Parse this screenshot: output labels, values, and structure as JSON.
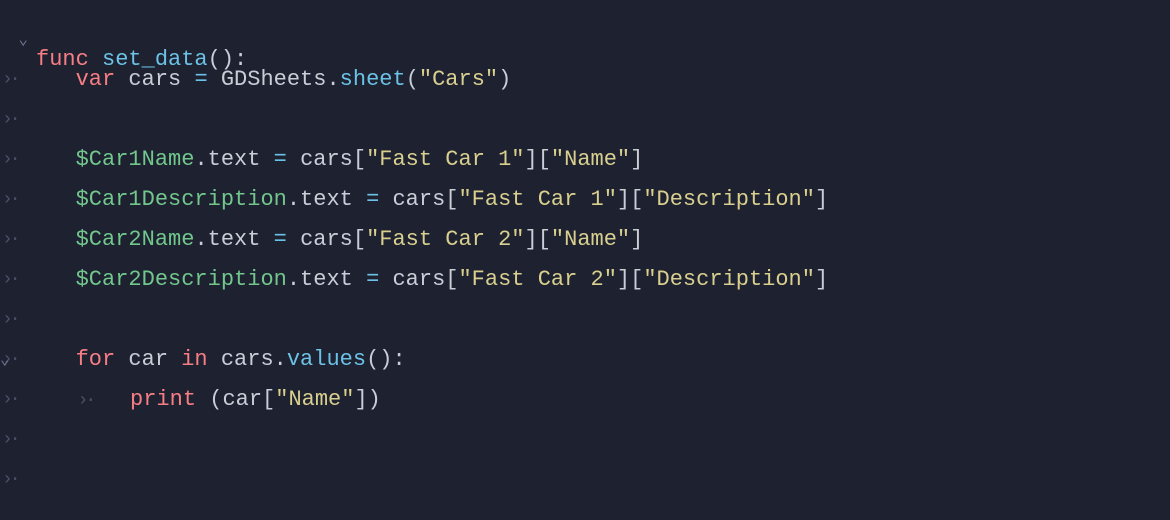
{
  "code": {
    "l1": {
      "func": "func",
      "name": "set_data",
      "parens": "()",
      "colon": ":"
    },
    "l2": {
      "var": "var",
      "cars": "cars",
      "eq": "=",
      "gds": "GDSheets",
      "dot": ".",
      "sheet": "sheet",
      "open": "(",
      "str": "\"Cars\"",
      "close": ")"
    },
    "l4": {
      "node": "$Car1Name",
      "dot": ".",
      "prop": "text",
      "eq": "=",
      "cars": "cars",
      "b1o": "[",
      "s1": "\"Fast Car 1\"",
      "b1c": "]",
      "b2o": "[",
      "s2": "\"Name\"",
      "b2c": "]"
    },
    "l5": {
      "node": "$Car1Description",
      "dot": ".",
      "prop": "text",
      "eq": "=",
      "cars": "cars",
      "b1o": "[",
      "s1": "\"Fast Car 1\"",
      "b1c": "]",
      "b2o": "[",
      "s2": "\"Description\"",
      "b2c": "]"
    },
    "l6": {
      "node": "$Car2Name",
      "dot": ".",
      "prop": "text",
      "eq": "=",
      "cars": "cars",
      "b1o": "[",
      "s1": "\"Fast Car 2\"",
      "b1c": "]",
      "b2o": "[",
      "s2": "\"Name\"",
      "b2c": "]"
    },
    "l7": {
      "node": "$Car2Description",
      "dot": ".",
      "prop": "text",
      "eq": "=",
      "cars": "cars",
      "b1o": "[",
      "s1": "\"Fast Car 2\"",
      "b1c": "]",
      "b2o": "[",
      "s2": "\"Description\"",
      "b2c": "]"
    },
    "l9": {
      "for": "for",
      "car": "car",
      "in": "in",
      "cars": "cars",
      "dot": ".",
      "values": "values",
      "parens": "()",
      "colon": ":"
    },
    "l10": {
      "print": "print",
      "sp": " ",
      "open": "(",
      "car": "car",
      "b1o": "[",
      "s1": "\"Name\"",
      "b1c": "]",
      "close": ")"
    }
  },
  "glyphs": {
    "fold": "⌄",
    "indent": "›·"
  }
}
